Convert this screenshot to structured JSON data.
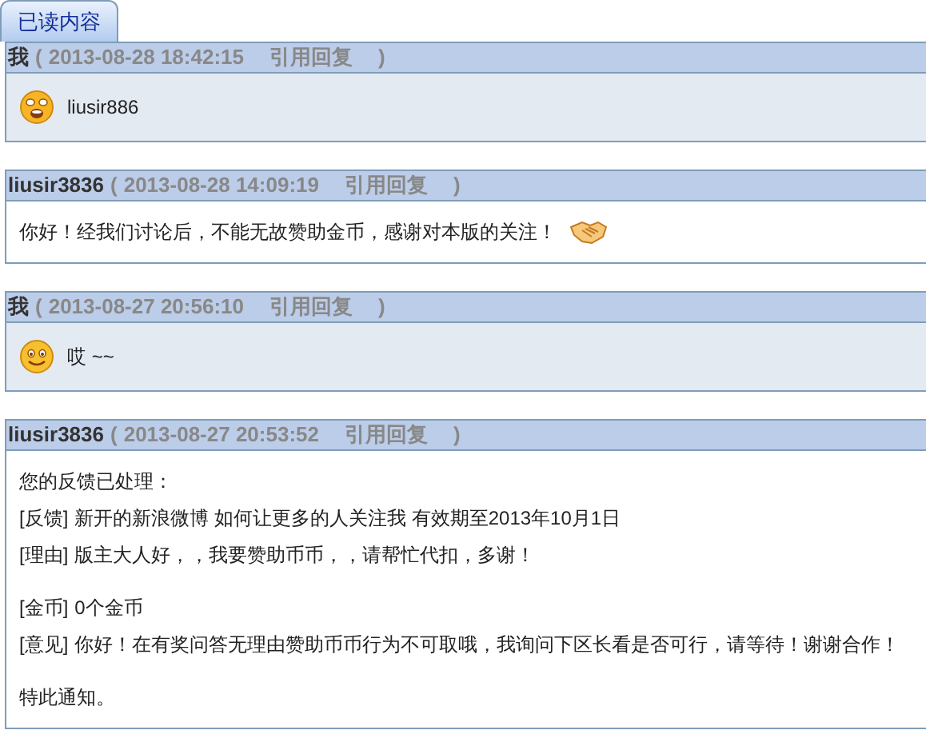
{
  "tab": {
    "label": "已读内容",
    "selected": true
  },
  "messages": [
    {
      "author": "我",
      "open": "(",
      "time": "2013-08-28 18:42:15",
      "quote": "引用回复",
      "close": ")",
      "mine": true,
      "blocks": [
        [
          {
            "segments": [
              {
                "kind": "crying_face"
              },
              {
                "kind": "text",
                "text": "liusir886"
              }
            ]
          }
        ]
      ]
    },
    {
      "author": "liusir3836",
      "open": "(",
      "time": "2013-08-28 14:09:19",
      "quote": "引用回复",
      "close": ")",
      "mine": false,
      "blocks": [
        [
          {
            "segments": [
              {
                "kind": "text",
                "text": "你好！经我们讨论后，不能无故赞助金币，感谢对本版的关注！"
              },
              {
                "kind": "handshake"
              }
            ]
          }
        ]
      ]
    },
    {
      "author": "我",
      "open": "(",
      "time": "2013-08-27 20:56:10",
      "quote": "引用回复",
      "close": ")",
      "mine": true,
      "blocks": [
        [
          {
            "segments": [
              {
                "kind": "smiling_face"
              },
              {
                "kind": "text",
                "text": "哎 ~~"
              }
            ]
          }
        ]
      ]
    },
    {
      "author": "liusir3836",
      "open": "(",
      "time": "2013-08-27 20:53:52",
      "quote": "引用回复",
      "close": ")",
      "mine": false,
      "blocks": [
        [
          {
            "segments": [
              {
                "kind": "text",
                "text": "您的反馈已处理："
              }
            ]
          },
          {
            "segments": [
              {
                "kind": "tag",
                "text": "[反馈]"
              },
              {
                "kind": "text",
                "text": "新开的新浪微博 如何让更多的人关注我 有效期至2013年10月1日"
              }
            ]
          },
          {
            "segments": [
              {
                "kind": "tag",
                "text": "[理由]"
              },
              {
                "kind": "text",
                "text": "版主大人好，，我要赞助币币，，请帮忙代扣，多谢！"
              }
            ]
          }
        ],
        [
          {
            "segments": [
              {
                "kind": "tag",
                "text": "[金币]"
              },
              {
                "kind": "text",
                "text": "0个金币"
              }
            ]
          },
          {
            "segments": [
              {
                "kind": "tag",
                "text": "[意见]"
              },
              {
                "kind": "text",
                "text": "你好！在有奖问答无理由赞助币币行为不可取哦，我询问下区长看是否可行，请等待！谢谢合作！"
              }
            ]
          }
        ],
        [
          {
            "segments": [
              {
                "kind": "text",
                "text": "特此通知。"
              }
            ]
          }
        ]
      ]
    }
  ]
}
